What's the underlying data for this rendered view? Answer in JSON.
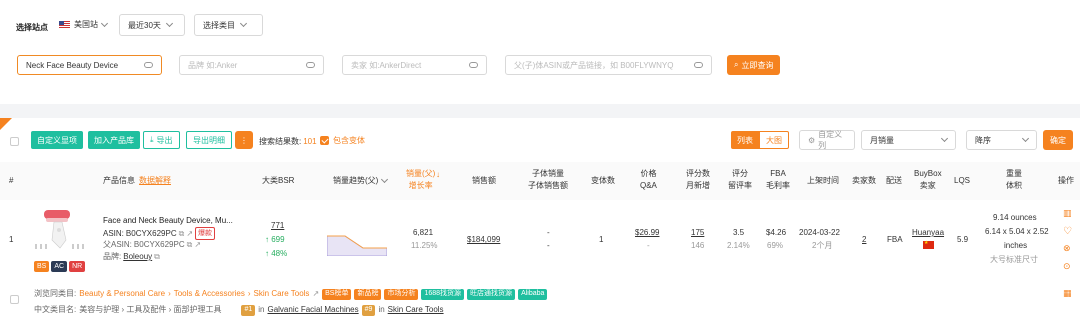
{
  "filters": {
    "site_label": "选择站点",
    "site_value": "美国站",
    "period_value": "最近30天",
    "category_placeholder": "选择类目",
    "keyword_value": "Neck Face Beauty Device",
    "brand_placeholder": "品牌 如:Anker",
    "seller_placeholder": "卖家 如:AnkerDirect",
    "asin_placeholder": "父(子)体ASIN或产品链接，如 B00FLYWNYQ",
    "search_button": "立即查询"
  },
  "toolbar": {
    "custom_display": "自定义显项",
    "add_to_library": "加入产品库",
    "export": "导出",
    "export_detail": "导出明细",
    "result_label": "搜索结果数:",
    "result_count": "101",
    "include_variants": "包含变体",
    "view_list": "列表",
    "view_grid": "大图",
    "custom_columns": "自定义列",
    "sort_field": "月销量",
    "sort_order": "降序",
    "confirm": "确定"
  },
  "columns": {
    "index": "#",
    "product_info": "产品信息",
    "data_explain": "数据解释",
    "bsr": "大类BSR",
    "sales_trend": "销量趋势(父)",
    "sales_parent": "销量(父)",
    "growth": "增长率",
    "revenue": "销售额",
    "child_sales": "子体销量",
    "child_revenue": "子体销售额",
    "variants": "变体数",
    "price": "价格",
    "qa": "Q&A",
    "reviews": "评分数",
    "monthly_new": "月新增",
    "rating": "评分",
    "review_rate": "留评率",
    "fba": "FBA",
    "margin": "毛利率",
    "listed": "上架时间",
    "sellers": "卖家数",
    "delivery": "配送",
    "buybox": "BuyBox",
    "buybox_seller": "卖家",
    "lqs": "LQS",
    "weight": "重量",
    "volume": "体积",
    "actions": "操作"
  },
  "row": {
    "index": "1",
    "title": "Face and Neck Beauty Device, Mu...",
    "asin_label": "ASIN:",
    "asin": "B0CYX629PC",
    "variant_tag": "爆款",
    "parent_asin_label": "父ASIN:",
    "parent_asin": "B0CYX629PC",
    "brand_label": "品牌:",
    "brand": "Boleouy",
    "badges": [
      "BS",
      "AC",
      "NR"
    ],
    "bsr": "771",
    "bsr_change": "699",
    "bsr_pct": "48%",
    "sales": "6,821",
    "growth": "11.25%",
    "revenue": "$184,099",
    "child_sales": "-",
    "child_revenue": "-",
    "variants": "1",
    "price": "$26.99",
    "qa": "-",
    "reviews": "175",
    "monthly_new": "146",
    "rating": "3.5",
    "review_rate": "2.14%",
    "fba": "$4.26",
    "margin": "69%",
    "listed": "2024-03-22",
    "listed_ago": "2个月",
    "sellers": "2",
    "delivery": "FBA",
    "buybox_seller": "Huanyaa",
    "lqs": "5.9",
    "weight": "9.14 ounces",
    "dimensions": "6.14 x 5.04 x 2.52",
    "dim_unit": "inches",
    "size_class": "大号标准尺寸",
    "trend": [
      60,
      60,
      20,
      20
    ]
  },
  "footer": {
    "browse_label": "浏览同类目:",
    "cat1": "Beauty & Personal Care",
    "cat2": "Tools & Accessories",
    "cat3": "Skin Care Tools",
    "tags": [
      "BS榜单",
      "新品榜",
      "市场分析",
      "1688找货源",
      "旺店通找货源",
      "Alibaba"
    ],
    "cn_label": "中文类目名:",
    "cn_path": "美容与护理 › 工具及配件 › 面部护理工具",
    "rank1_num": "#1",
    "rank1_in": "in",
    "rank1_cat": "Galvanic Facial Machines",
    "rank2_num": "#9",
    "rank2_in": "in",
    "rank2_cat": "Skin Care Tools"
  },
  "colors": {
    "accent": "#f5821f",
    "teal": "#1fbf9f",
    "green": "#27ae60"
  }
}
